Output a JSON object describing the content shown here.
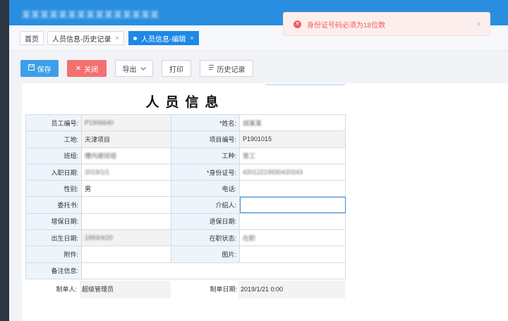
{
  "header": {
    "app_title": "某某某某某某某某某某某某某某某"
  },
  "tabs": [
    {
      "label": "首页"
    },
    {
      "label": "人员信息-历史记录",
      "close": "×"
    },
    {
      "label": "人员信息-编辑",
      "close": "×",
      "active": true
    }
  ],
  "toolbar": {
    "save_label": "保存",
    "close_label": "关闭",
    "export_label": "导出",
    "print_label": "打印",
    "history_label": "历史记录"
  },
  "form": {
    "title": "人员信息",
    "rows": [
      [
        {
          "label": "员工编号:",
          "value": "P1906640",
          "blur": true,
          "ro": true
        },
        {
          "label": "*姓名:",
          "value": "胡某某",
          "blur": true
        }
      ],
      [
        {
          "label": "工地:",
          "value": "天津项目",
          "ro": true
        },
        {
          "label": "项目编号:",
          "value": "P1901015",
          "ro": true
        }
      ],
      [
        {
          "label": "班组:",
          "value": "槽内建班组",
          "blur": true
        },
        {
          "label": "工种:",
          "value": "普工",
          "blur": true
        }
      ],
      [
        {
          "label": "入职日期:",
          "value": "2019/1/1",
          "blur": true
        },
        {
          "label": "*身份证号:",
          "value": "42012219930420243",
          "blur": true
        }
      ],
      [
        {
          "label": "性别:",
          "value": "男"
        },
        {
          "label": "电话:",
          "value": ""
        }
      ],
      [
        {
          "label": "委托书:",
          "value": ""
        },
        {
          "label": "介绍人:",
          "value": "",
          "focus": true
        }
      ],
      [
        {
          "label": "增保日期:",
          "value": ""
        },
        {
          "label": "退保日期:",
          "value": ""
        }
      ],
      [
        {
          "label": "出生日期:",
          "value": "1993/4/20",
          "blur": true,
          "ro": true
        },
        {
          "label": "在职状态:",
          "value": "在职",
          "blur": true
        }
      ],
      [
        {
          "label": "附件:",
          "value": ""
        },
        {
          "label": "图片:",
          "value": ""
        }
      ]
    ],
    "remark_label": "备注信息:",
    "remark_value": "",
    "creator_label": "制单人:",
    "creator_value": "超级管理员",
    "date_label": "制单日期:",
    "date_value": "2019/1/21 0:00"
  },
  "toast": {
    "message": "身份证号码必须为18位数",
    "type": "error",
    "close": "×"
  },
  "colors": {
    "header_bg": "#2a8ee0",
    "tab_active": "#1e88e5",
    "save_btn": "#3d9fe8",
    "close_btn": "#f47070",
    "toast_text": "#f25c5c"
  }
}
